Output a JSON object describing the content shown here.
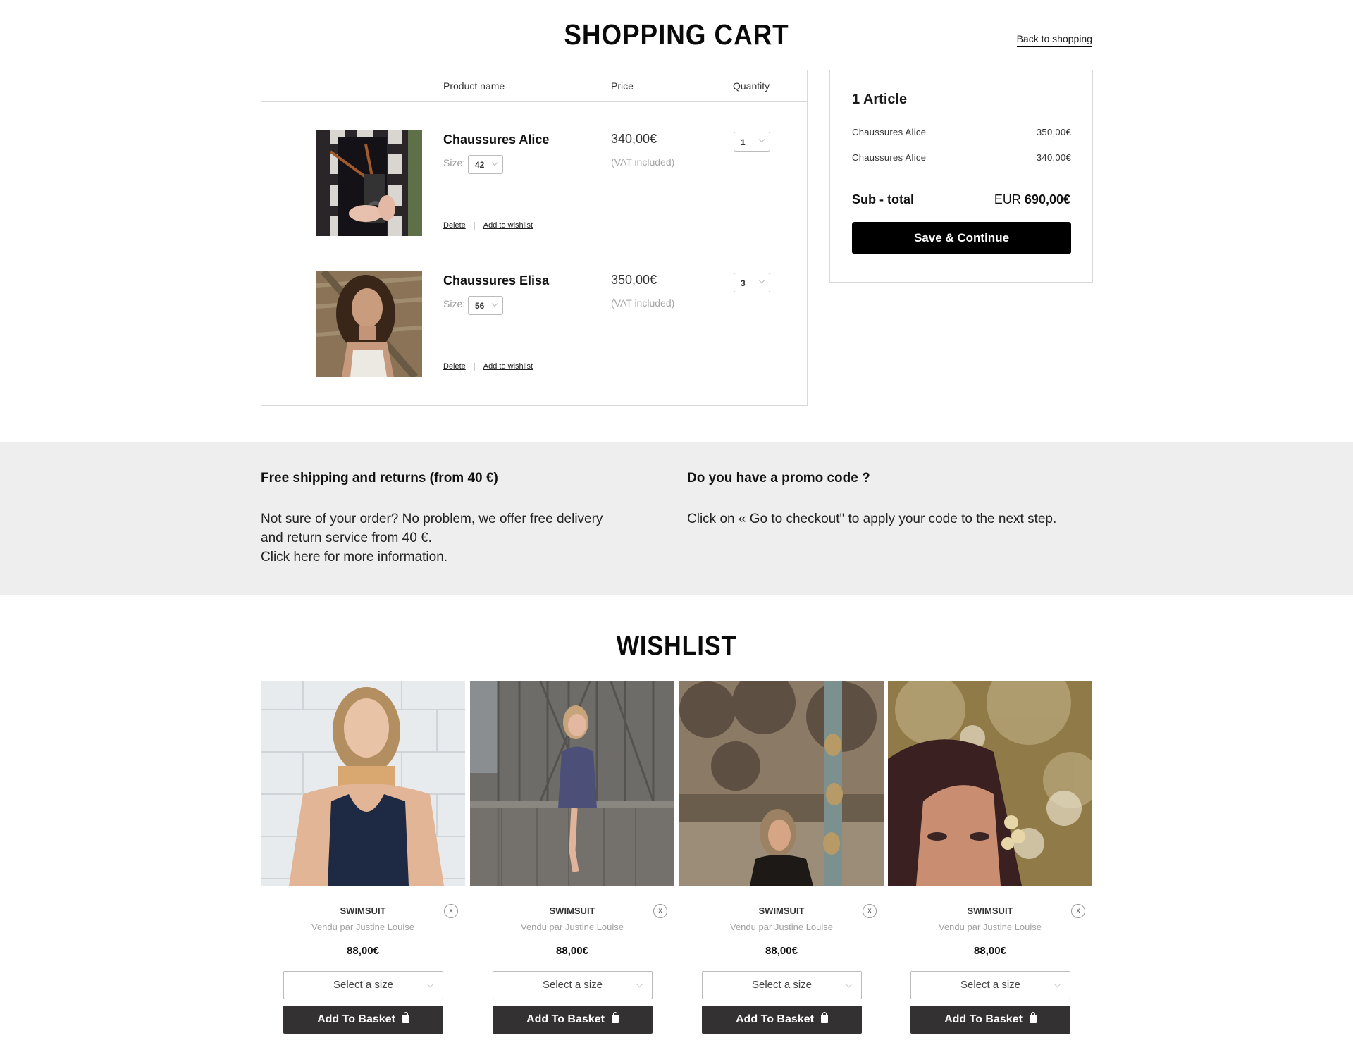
{
  "header": {
    "title": "SHOPPING CART",
    "back_link": "Back to shopping"
  },
  "cart": {
    "columns": [
      "Product name",
      "Price",
      "Quantity"
    ],
    "size_label": "Size:",
    "vat_label": "(VAT included)",
    "delete_label": "Delete",
    "wishlist_label": "Add to wishlist",
    "items": [
      {
        "name": "Chaussures Alice",
        "size": "42",
        "price": "340,00€",
        "quantity": "1",
        "image": "person-with-camera"
      },
      {
        "name": "Chaussures Elisa",
        "size": "56",
        "price": "350,00€",
        "quantity": "3",
        "image": "woman-portrait"
      }
    ]
  },
  "summary": {
    "title": "1 Article",
    "lines": [
      {
        "name": "Chaussures Alice",
        "price": "350,00€"
      },
      {
        "name": "Chaussures Alice",
        "price": "340,00€"
      }
    ],
    "subtotal_label": "Sub - total",
    "currency": "EUR",
    "subtotal_value": "690,00€",
    "button": "Save & Continue"
  },
  "info": {
    "shipping": {
      "heading": "Free shipping and returns (from 40 €)",
      "line1": "Not sure of your order? No problem, we offer free delivery",
      "line2": "and return service from 40 €.",
      "link": "Click here",
      "line3_rest": " for more information."
    },
    "promo": {
      "heading": "Do you have a promo code ?",
      "text": "Click on « Go to checkout\" to apply your code to the next step."
    }
  },
  "wishlist": {
    "title": "WISHLIST",
    "remove_glyph": "x",
    "items": [
      {
        "name": "SWIMSUIT",
        "seller": "Vendu par Justine Louise",
        "price": "88,00€",
        "size_placeholder": "Select a size",
        "button": "Add To Basket"
      },
      {
        "name": "SWIMSUIT",
        "seller": "Vendu par Justine Louise",
        "price": "88,00€",
        "size_placeholder": "Select a size",
        "button": "Add To Basket"
      },
      {
        "name": "SWIMSUIT",
        "seller": "Vendu par Justine Louise",
        "price": "88,00€",
        "size_placeholder": "Select a size",
        "button": "Add To Basket"
      },
      {
        "name": "SWIMSUIT",
        "seller": "Vendu par Justine Louise",
        "price": "88,00€",
        "size_placeholder": "Select a size",
        "button": "Add To Basket"
      }
    ]
  }
}
